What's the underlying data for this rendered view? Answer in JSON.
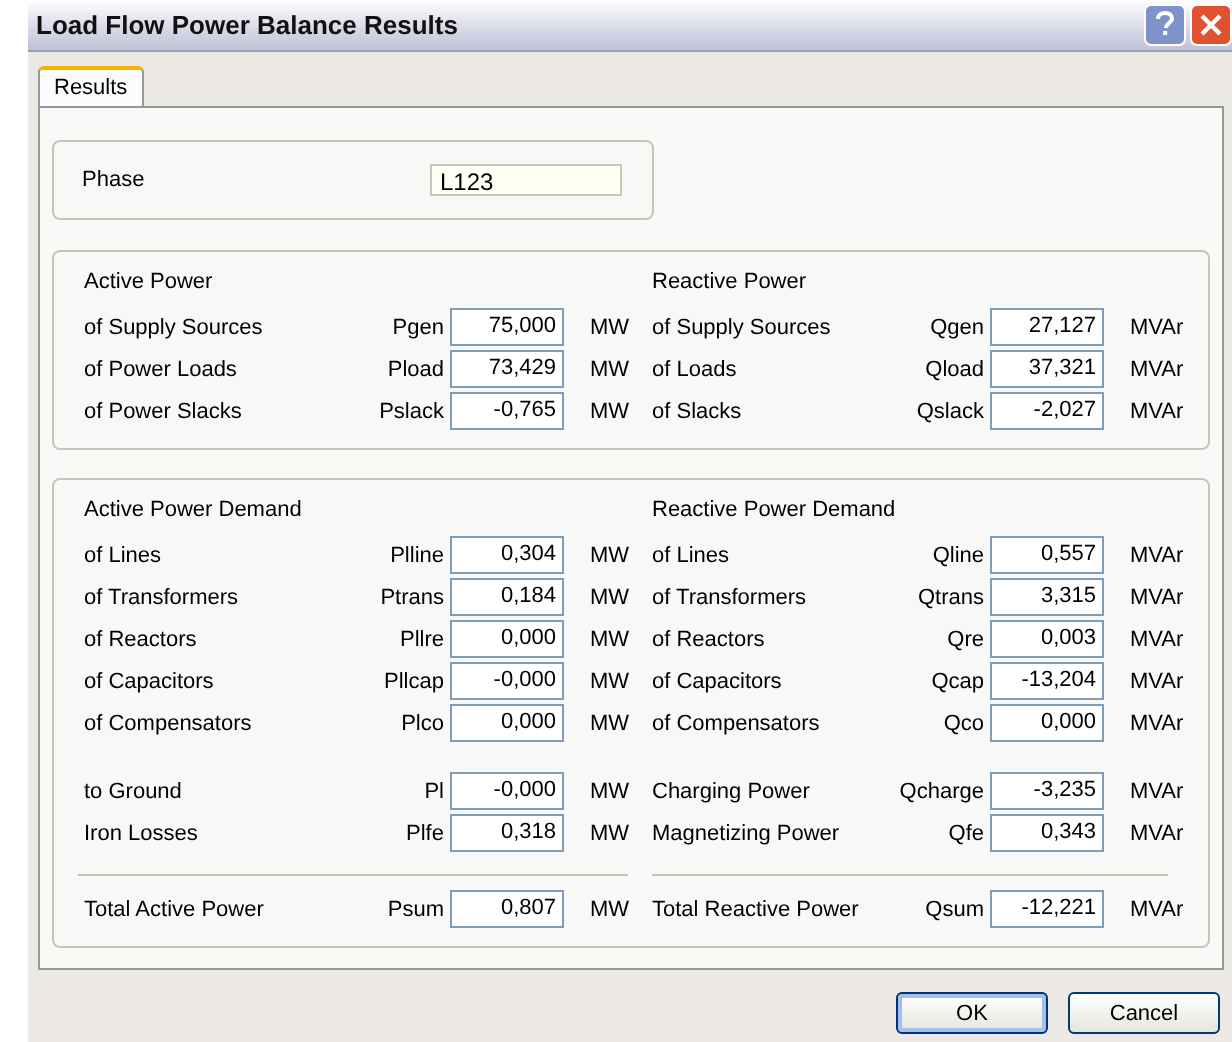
{
  "window": {
    "title": "Load Flow Power Balance Results"
  },
  "tabs": [
    {
      "label": "Results",
      "selected": true
    }
  ],
  "phase": {
    "label": "Phase",
    "value": "L123"
  },
  "groups": [
    {
      "columns": [
        {
          "heading": "Active Power",
          "blocks": [
            [
              {
                "label": "of  Supply Sources",
                "symbol": "Pgen",
                "value": "75,000",
                "unit": "MW"
              },
              {
                "label": "of Power Loads",
                "symbol": "Pload",
                "value": "73,429",
                "unit": "MW"
              },
              {
                "label": "of Power Slacks",
                "symbol": "Pslack",
                "value": "-0,765",
                "unit": "MW"
              }
            ]
          ]
        },
        {
          "heading": "Reactive Power",
          "blocks": [
            [
              {
                "label": "of Supply Sources",
                "symbol": "Qgen",
                "value": "27,127",
                "unit": "MVAr"
              },
              {
                "label": "of Loads",
                "symbol": "Qload",
                "value": "37,321",
                "unit": "MVAr"
              },
              {
                "label": "of Slacks",
                "symbol": "Qslack",
                "value": "-2,027",
                "unit": "MVAr"
              }
            ]
          ]
        }
      ]
    },
    {
      "columns": [
        {
          "heading": "Active Power Demand",
          "blocks": [
            [
              {
                "label": "of Lines",
                "symbol": "Plline",
                "value": "0,304",
                "unit": "MW"
              },
              {
                "label": "of Transformers",
                "symbol": "Ptrans",
                "value": "0,184",
                "unit": "MW"
              },
              {
                "label": "of Reactors",
                "symbol": "Pllre",
                "value": "0,000",
                "unit": "MW"
              },
              {
                "label": "of Capacitors",
                "symbol": "Pllcap",
                "value": "-0,000",
                "unit": "MW"
              },
              {
                "label": "of Compensators",
                "symbol": "Plco",
                "value": "0,000",
                "unit": "MW"
              }
            ],
            [
              {
                "label": "to Ground",
                "symbol": "Pl",
                "value": "-0,000",
                "unit": "MW"
              },
              {
                "label": "Iron Losses",
                "symbol": "Plfe",
                "value": "0,318",
                "unit": "MW"
              }
            ]
          ],
          "total": {
            "label": "Total Active Power",
            "symbol": "Psum",
            "value": "0,807",
            "unit": "MW"
          }
        },
        {
          "heading": "Reactive Power Demand",
          "blocks": [
            [
              {
                "label": "of Lines",
                "symbol": "Qline",
                "value": "0,557",
                "unit": "MVAr"
              },
              {
                "label": "of Transformers",
                "symbol": "Qtrans",
                "value": "3,315",
                "unit": "MVAr"
              },
              {
                "label": "of Reactors",
                "symbol": "Qre",
                "value": "0,003",
                "unit": "MVAr"
              },
              {
                "label": "of Capacitors",
                "symbol": "Qcap",
                "value": "-13,204",
                "unit": "MVAr"
              },
              {
                "label": "of Compensators",
                "symbol": "Qco",
                "value": "0,000",
                "unit": "MVAr"
              }
            ],
            [
              {
                "label": "Charging Power",
                "symbol": "Qcharge",
                "value": "-3,235",
                "unit": "MVAr"
              },
              {
                "label": "Magnetizing Power",
                "symbol": "Qfe",
                "value": "0,343",
                "unit": "MVAr"
              }
            ]
          ],
          "total": {
            "label": "Total Reactive Power",
            "symbol": "Qsum",
            "value": "-12,221",
            "unit": "MVAr"
          }
        }
      ]
    }
  ],
  "buttons": [
    {
      "label": "OK",
      "default": true
    },
    {
      "label": "Cancel",
      "default": false
    }
  ]
}
